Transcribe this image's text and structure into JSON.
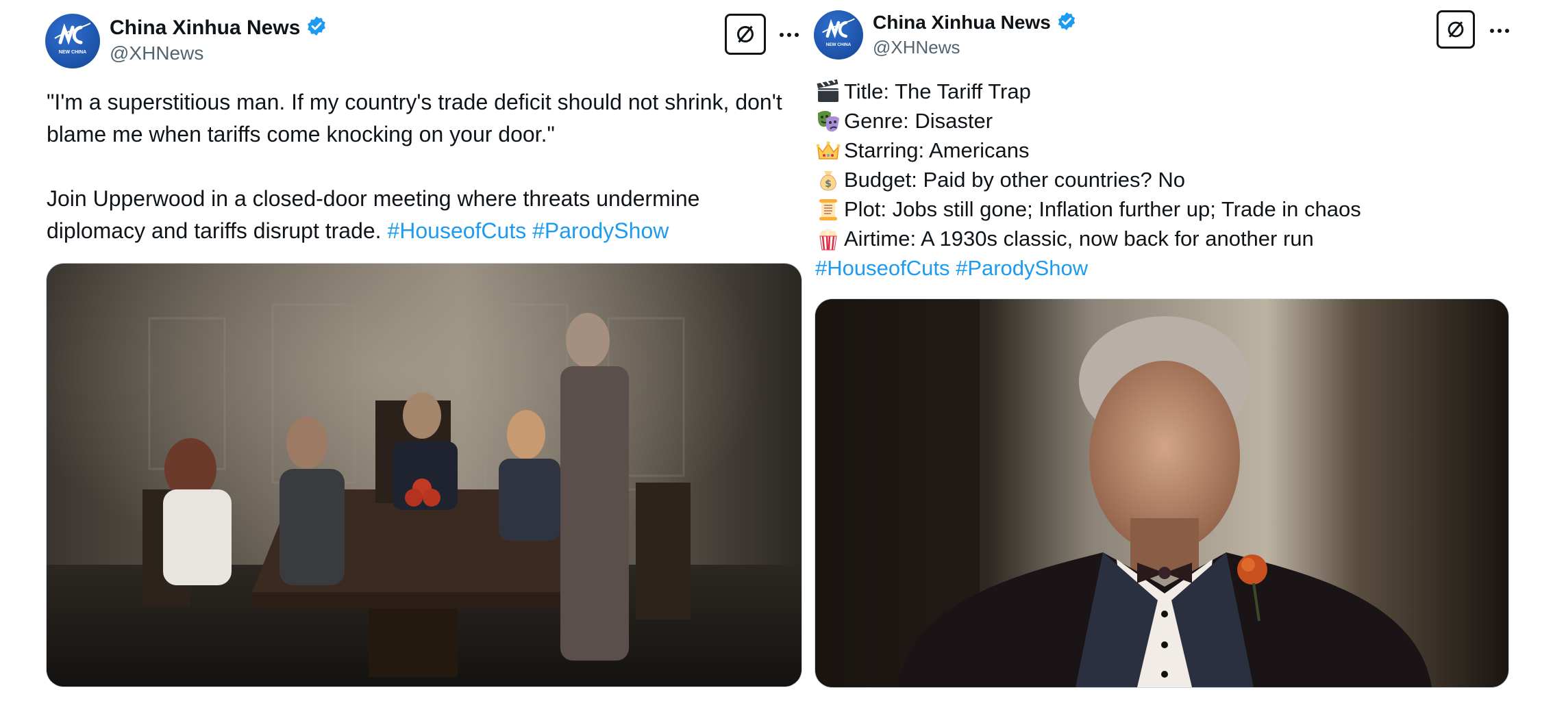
{
  "colors": {
    "accent": "#1d9bf0",
    "text": "#0f1419",
    "secondary": "#536471",
    "verified": "#1d9bf0"
  },
  "post_left": {
    "author": {
      "name": "China Xinhua News",
      "handle": "@XHNews",
      "avatar_text": "NEW CHINA"
    },
    "quote": "\"I'm a superstitious man. If my country's trade deficit should not shrink, don't blame me when tariffs come knocking on your door.\"",
    "body": "Join Upperwood in a closed-door meeting where threats undermine diplomacy and tariffs disrupt trade.",
    "hashtags": [
      "#HouseofCuts",
      "#ParodyShow"
    ],
    "icons": {
      "grok": "grok-icon",
      "more": "more-icon",
      "verified": "verified-badge-icon"
    }
  },
  "post_right": {
    "author": {
      "name": "China Xinhua News",
      "handle": "@XHNews",
      "avatar_text": "NEW CHINA"
    },
    "lines": [
      {
        "icon": "clapper-board-icon",
        "text": "Title: The Tariff Trap"
      },
      {
        "icon": "performing-arts-icon",
        "text": "Genre: Disaster"
      },
      {
        "icon": "crown-icon",
        "text": "Starring: Americans"
      },
      {
        "icon": "money-bag-icon",
        "text": "Budget: Paid by other countries? No"
      },
      {
        "icon": "scroll-icon",
        "text": "Plot: Jobs still gone; Inflation further up; Trade in chaos"
      },
      {
        "icon": "popcorn-icon",
        "text": "Airtime: A 1930s classic, now back for another run"
      }
    ],
    "hashtags": [
      "#HouseofCuts",
      "#ParodyShow"
    ],
    "icons": {
      "grok": "grok-icon",
      "more": "more-icon",
      "verified": "verified-badge-icon"
    }
  }
}
